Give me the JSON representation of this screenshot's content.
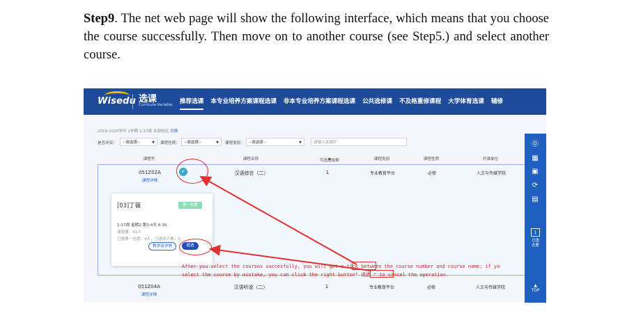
{
  "step": {
    "label": "Step9",
    "text": ". The net web page will show the following interface, which means that you choose the course successfully. Then move on to another course (see Step5.) and select another course."
  },
  "app": {
    "logo": "Wisedu",
    "title": "选课",
    "subtitle": "Curricula-Variable",
    "nav": [
      "推荐选课",
      "本专业培养方案课程选课",
      "非本专业培养方案课程选课",
      "公共选修课",
      "不及格重修课程",
      "大学体育选课",
      "辅修"
    ]
  },
  "term": {
    "text": "2019-2020学年 2学期 1-17周 本部校区",
    "switch": "切换"
  },
  "filters": {
    "conflict_label": "是否冲突：",
    "conflict_value": "--请选择--",
    "nature_label": "课程性质：",
    "nature_value": "--请选择--",
    "category_label": "课程类别：",
    "category_value": "--请选择--",
    "search_placeholder": "请输入关键字"
  },
  "table": {
    "headers": [
      "课程号",
      "课程名称",
      "可选班级数",
      "课程类别",
      "课程性质",
      "开课单位"
    ],
    "sort_icon": "◆",
    "rows": [
      {
        "code": "051Z02A",
        "detail": "课程详情",
        "name": "汉语综合（二）",
        "classes": "1",
        "category": "专业教育平台",
        "nature": "必修",
        "unit": "人文与传媒学院"
      },
      {
        "code": "051Z04A",
        "detail": "课程详情",
        "name": "汉语听说（二）",
        "classes": "1",
        "category": "专业教育平台",
        "nature": "必修",
        "unit": "人文与传媒学院"
      }
    ]
  },
  "card": {
    "teacher": "[03]丁薇",
    "badge": "第一志愿",
    "schedule": "1-17周 星期2 第3-4节 8-30.",
    "capacity": "课容量：61人",
    "selected": "已报第一志愿：4人，已选中人数：5",
    "eval_button": "教学班详情",
    "drop_button": "退选"
  },
  "annotation": {
    "line1": "After you select the courses succesfully, you will get a tick between the course number and course name; if yo",
    "line2": "select the course by mistake, you can click the right button\"  退选 \" to cancel the operation."
  },
  "sidebar": {
    "cart_count": "1",
    "cart_label": "已选\n志愿",
    "top_label": "TOP"
  }
}
